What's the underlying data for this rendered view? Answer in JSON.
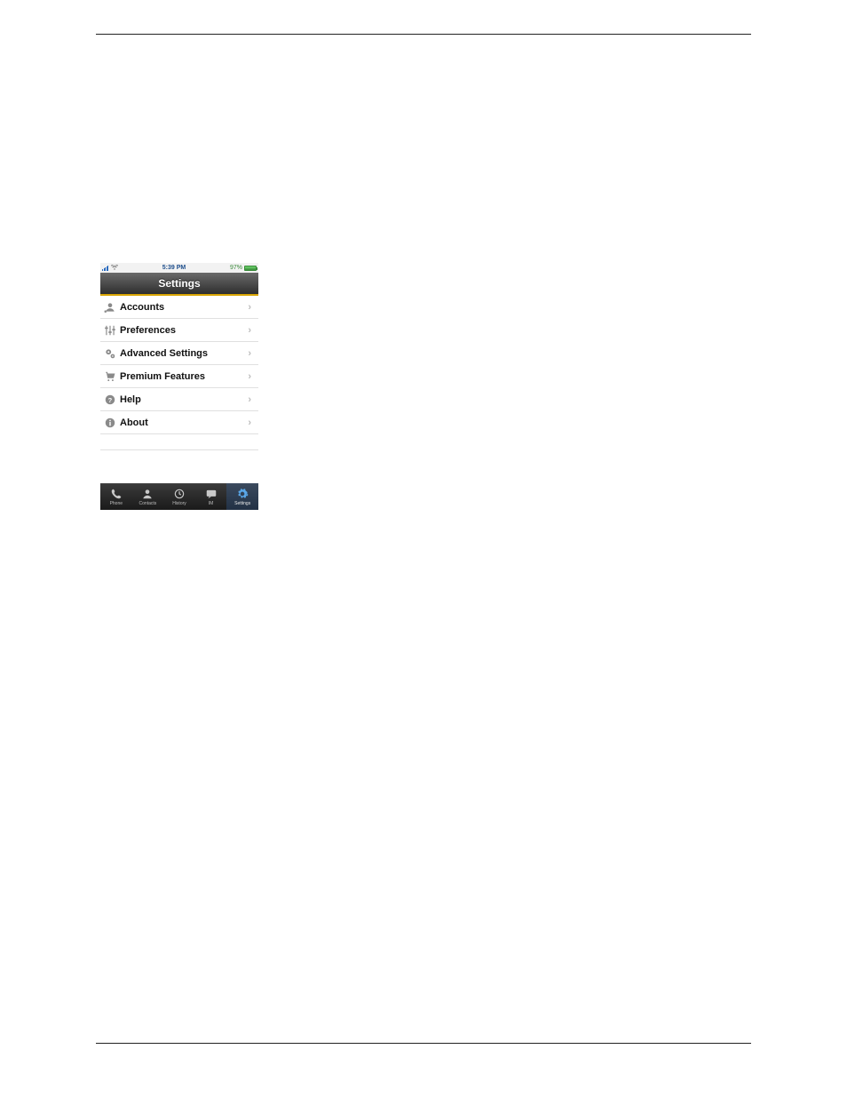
{
  "status_bar": {
    "time": "5:39 PM",
    "battery_percent": "97%"
  },
  "nav": {
    "title": "Settings"
  },
  "rows": [
    {
      "label": "Accounts"
    },
    {
      "label": "Preferences"
    },
    {
      "label": "Advanced Settings"
    },
    {
      "label": "Premium Features"
    },
    {
      "label": "Help"
    },
    {
      "label": "About"
    }
  ],
  "tabs": [
    {
      "label": "Phone"
    },
    {
      "label": "Contacts"
    },
    {
      "label": "History"
    },
    {
      "label": "IM"
    },
    {
      "label": "Settings"
    }
  ]
}
